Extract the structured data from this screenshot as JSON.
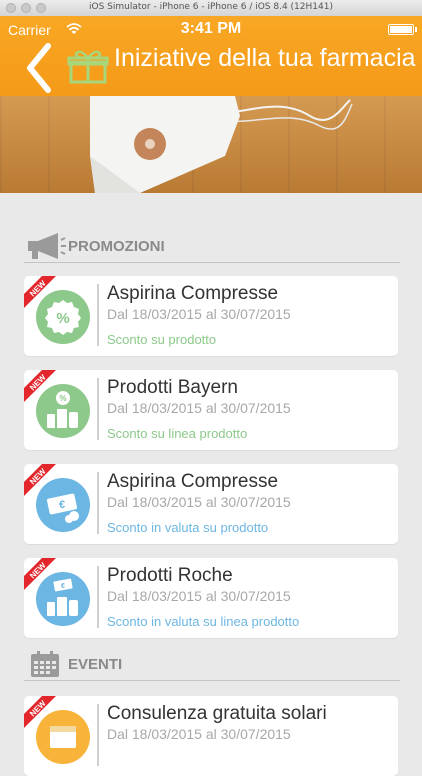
{
  "window": {
    "title": "iOS Simulator - iPhone 6 - iPhone 6 / iOS 8.4 (12H141)"
  },
  "statusbar": {
    "carrier": "Carrier",
    "time": "3:41 PM"
  },
  "nav": {
    "title": "Iniziative della tua farmacia"
  },
  "colors": {
    "orange": "#f59a19",
    "green": "#8cc98a",
    "blue": "#6cb6e3",
    "ribbon": "#e3262b"
  },
  "sections": {
    "promozioni": "PROMOZIONI",
    "eventi": "EVENTI"
  },
  "ribbon_text": "NEW",
  "cards": [
    {
      "title": "Aspirina Compresse",
      "date": "Dal 18/03/2015 al 30/07/2015",
      "type": "Sconto su prodotto",
      "icon": "percent-icon"
    },
    {
      "title": "Prodotti Bayern",
      "date": "Dal 18/03/2015 al 30/07/2015",
      "type": "Sconto su linea prodotto",
      "icon": "product-line-icon"
    },
    {
      "title": "Aspirina Compresse",
      "date": "Dal 18/03/2015 al 30/07/2015",
      "type": "Sconto in valuta su prodotto",
      "icon": "euro-bill-icon"
    },
    {
      "title": "Prodotti Roche",
      "date": "Dal 18/03/2015 al 30/07/2015",
      "type": "Sconto in valuta su linea prodotto",
      "icon": "euro-product-line-icon"
    },
    {
      "title": "Consulenza gratuita solari",
      "date": "Dal 18/03/2015 al 30/07/2015",
      "type": "",
      "icon": "event-icon"
    }
  ]
}
